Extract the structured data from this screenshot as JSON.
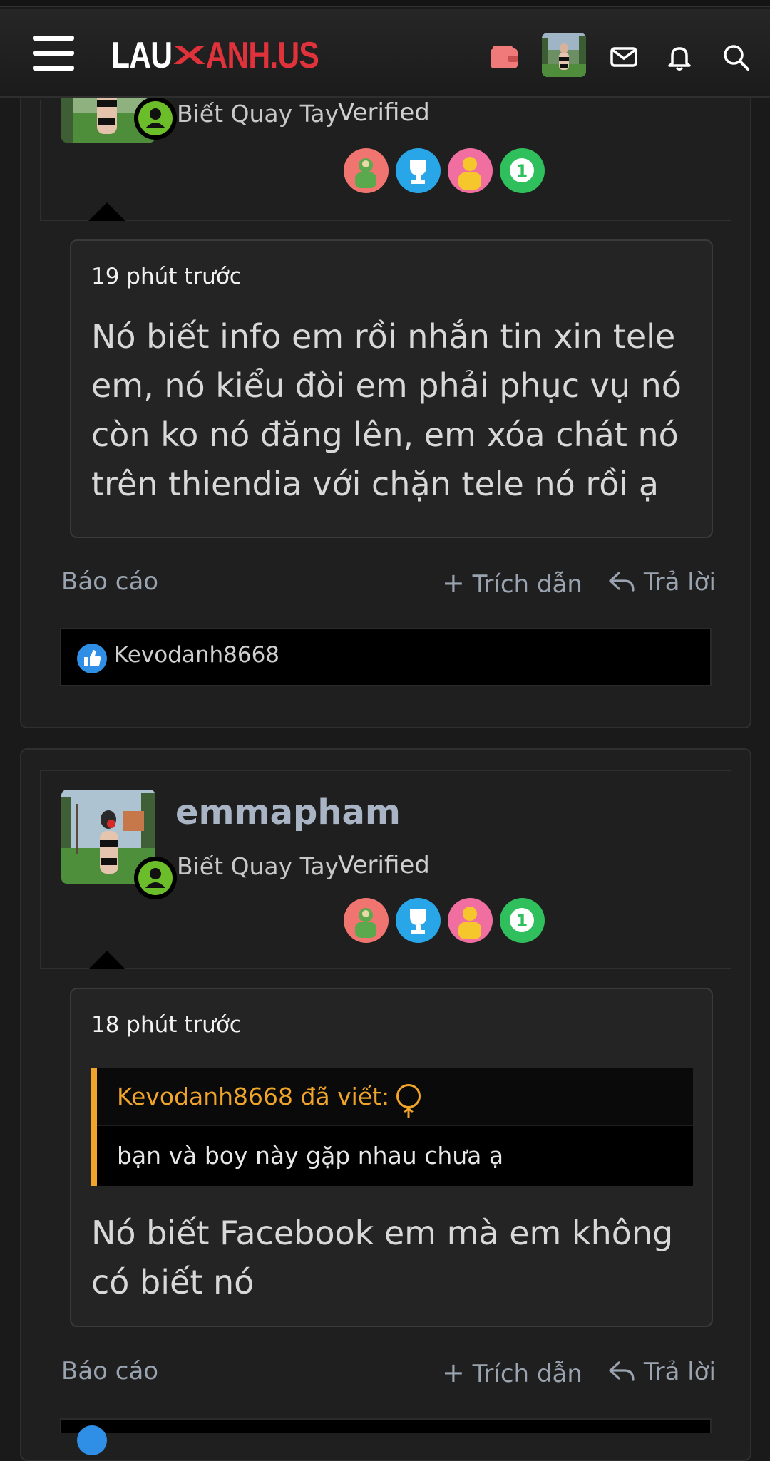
{
  "header": {
    "logo_left": "LAU",
    "logo_mark": "X",
    "logo_right": "ANH.US",
    "icons": [
      "menu-icon",
      "wallet-icon",
      "avatar",
      "mail-icon",
      "bell-icon",
      "search-icon"
    ]
  },
  "posts": [
    {
      "user_title": "Biết Quay Tay",
      "verified": "Verified",
      "time": "19 phút trước",
      "text": "Nó biết info em rồi nhắn tin xin tele em, nó kiểu đòi em phải phục vụ nó còn ko nó đăng lên, em xóa chát nó trên thiendia với chặn tele nó rồi ạ",
      "actions": {
        "report": "Báo cáo",
        "quote": "Trích dẫn",
        "reply": "Trả lời"
      },
      "liker": "Kevodanh8668"
    },
    {
      "username": "emmapham",
      "user_title": "Biết Quay Tay",
      "verified": "Verified",
      "time": "18 phút trước",
      "quote_author": "Kevodanh8668 đã viết:",
      "quote_text": "bạn và boy này gặp nhau chưa ạ",
      "text": "Nó biết Facebook em mà em không có biết nó",
      "actions": {
        "report": "Báo cáo",
        "quote": "Trích dẫn",
        "reply": "Trả lời"
      }
    }
  ],
  "colors": {
    "accent_orange": "#f0a52a",
    "logo_red": "#e0323b",
    "online_green": "#6bbd2a",
    "like_blue": "#2f8fe6"
  }
}
